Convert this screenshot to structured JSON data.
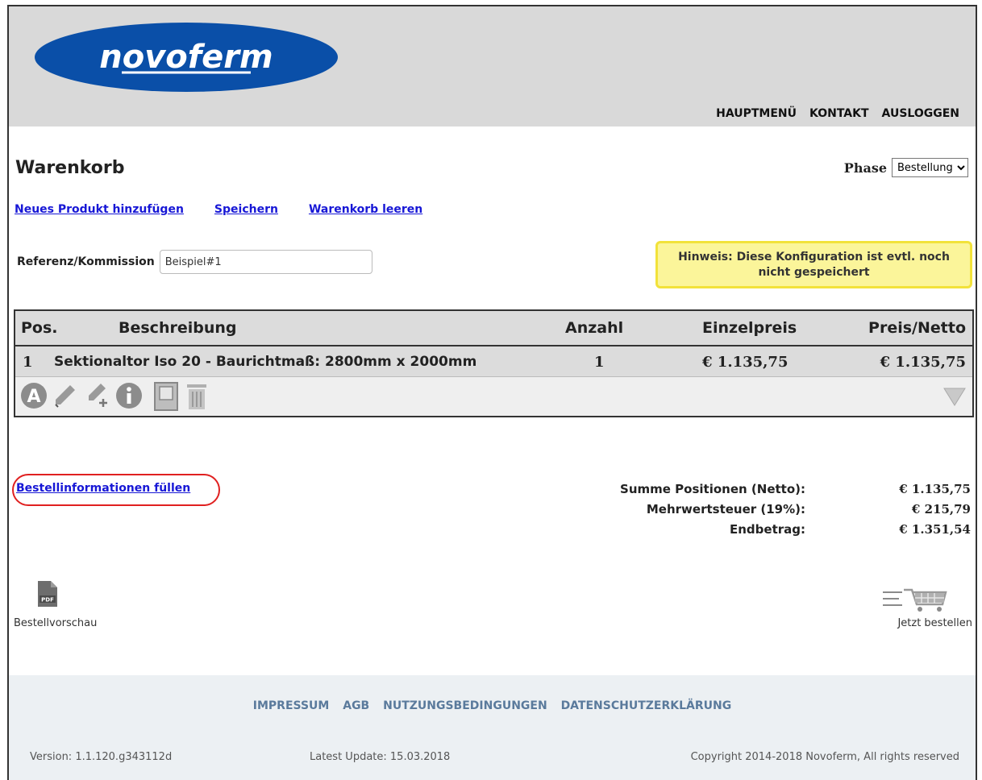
{
  "header": {
    "brand": "novoferm",
    "nav": [
      "HAUPTMENÜ",
      "KONTAKT",
      "AUSLOGGEN"
    ]
  },
  "page": {
    "title": "Warenkorb",
    "phase_label": "Phase",
    "phase_value": "Bestellung",
    "actions": [
      "Neues Produkt hinzufügen",
      "Speichern",
      "Warenkorb leeren"
    ]
  },
  "reference": {
    "label": "Referenz/Kommission",
    "value": "Beispiel#1"
  },
  "notice": "Hinweis: Diese Konfiguration ist evtl. noch nicht gespeichert",
  "table": {
    "headers": [
      "Pos.",
      "Beschreibung",
      "Anzahl",
      "Einzelpreis",
      "Preis/Netto"
    ],
    "rows": [
      {
        "pos": "1",
        "desc": "Sektionaltor Iso 20 - Baurichtmaß: 2800mm x 2000mm",
        "qty": "1",
        "unit": "€ 1.135,75",
        "net": "€ 1.135,75"
      }
    ],
    "row_icons": [
      "a-icon",
      "pencil-icon",
      "pencil-plus-icon",
      "info-icon",
      "door-icon",
      "trash-icon",
      "expand-triangle-icon"
    ]
  },
  "order_info_link": "Bestellinformationen füllen",
  "totals": [
    {
      "label": "Summe Positionen (Netto):",
      "value": "€ 1.135,75"
    },
    {
      "label": "Mehrwertsteuer (19%):",
      "value": "€ 215,79"
    },
    {
      "label": "Endbetrag:",
      "value": "€ 1.351,54"
    }
  ],
  "preview": {
    "icon": "pdf-icon",
    "badge": "PDF",
    "label": "Bestellvorschau"
  },
  "order": {
    "icon": "cart-icon",
    "label": "Jetzt bestellen"
  },
  "footer": {
    "links": [
      "IMPRESSUM",
      "AGB",
      "NUTZUNGSBEDINGUNGEN",
      "DATENSCHUTZERKLÄRUNG"
    ],
    "version": "Version: 1.1.120.g343112d",
    "update": "Latest Update: 15.03.2018",
    "copyright": "Copyright 2014-2018 Novoferm, All rights reserved"
  },
  "colors": {
    "brand_blue": "#0a4fa8",
    "link": "#1717d6",
    "notice_bg": "#fbf59a",
    "notice_border": "#f2e23a",
    "highlight_oval": "#e02020"
  }
}
